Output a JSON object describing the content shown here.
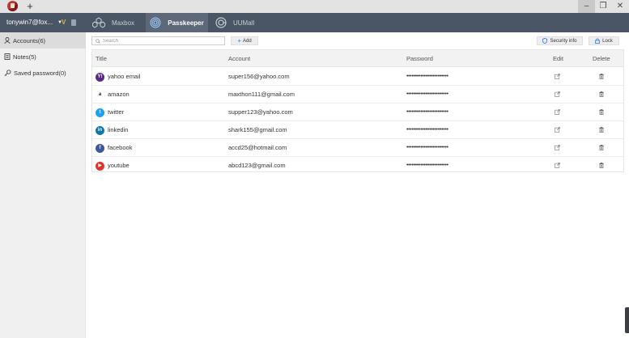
{
  "titlebar": {
    "new_tab_label": "+",
    "min_label": "–",
    "max_label": "❐",
    "close_label": "✕"
  },
  "header": {
    "username": "tonywin7@fox...",
    "caret": "▼",
    "vip_label": "V",
    "tabs": [
      {
        "label": "Maxbox",
        "icon": "maxbox-icon"
      },
      {
        "label": "Passkeeper",
        "icon": "fingerprint-icon"
      },
      {
        "label": "UUMall",
        "icon": "uumall-icon"
      }
    ]
  },
  "sidebar": {
    "items": [
      {
        "label": "Accounts(6)",
        "icon": "user-icon"
      },
      {
        "label": "Notes(5)",
        "icon": "notes-icon"
      },
      {
        "label": "Saved password(0)",
        "icon": "key-icon"
      }
    ]
  },
  "toolbar": {
    "search_placeholder": "Search",
    "add_label": "Add",
    "security_label": "Security info",
    "lock_label": "Lock"
  },
  "table": {
    "headers": {
      "title": "Title",
      "account": "Account",
      "password": "Password",
      "edit": "Edit",
      "delete": "Delete"
    },
    "rows": [
      {
        "title": "yahoo email",
        "account": "super156@yahoo.com",
        "password": "••••••••••••••••••••••••",
        "icon_color": "#5b2a86",
        "icon_glyph": "Y!"
      },
      {
        "title": "amazon",
        "account": "maxthon111@gmail.com",
        "password": "••••••••••••••••••••••••",
        "icon_color": "#ffffff",
        "icon_glyph": "a"
      },
      {
        "title": "twitter",
        "account": "supper123@yahoo.com",
        "password": "••••••••••••••••••••••••",
        "icon_color": "#1da1f2",
        "icon_glyph": "t"
      },
      {
        "title": "linkedin",
        "account": "shark155@gmail.com",
        "password": "••••••••••••••••••••••••",
        "icon_color": "#0e76a8",
        "icon_glyph": "in"
      },
      {
        "title": "facebook",
        "account": "accd25@hotmail.com",
        "password": "••••••••••••••••••••••••",
        "icon_color": "#3b5998",
        "icon_glyph": "f"
      },
      {
        "title": "youtube",
        "account": "abcd123@gmail.com",
        "password": "••••••••••••••••••••••••",
        "icon_color": "#e0332b",
        "icon_glyph": "▶"
      }
    ]
  },
  "colors": {
    "header_bg": "#4a5565",
    "active_tab_bg": "#5d6878",
    "accent_blue": "#2a7ae2"
  }
}
